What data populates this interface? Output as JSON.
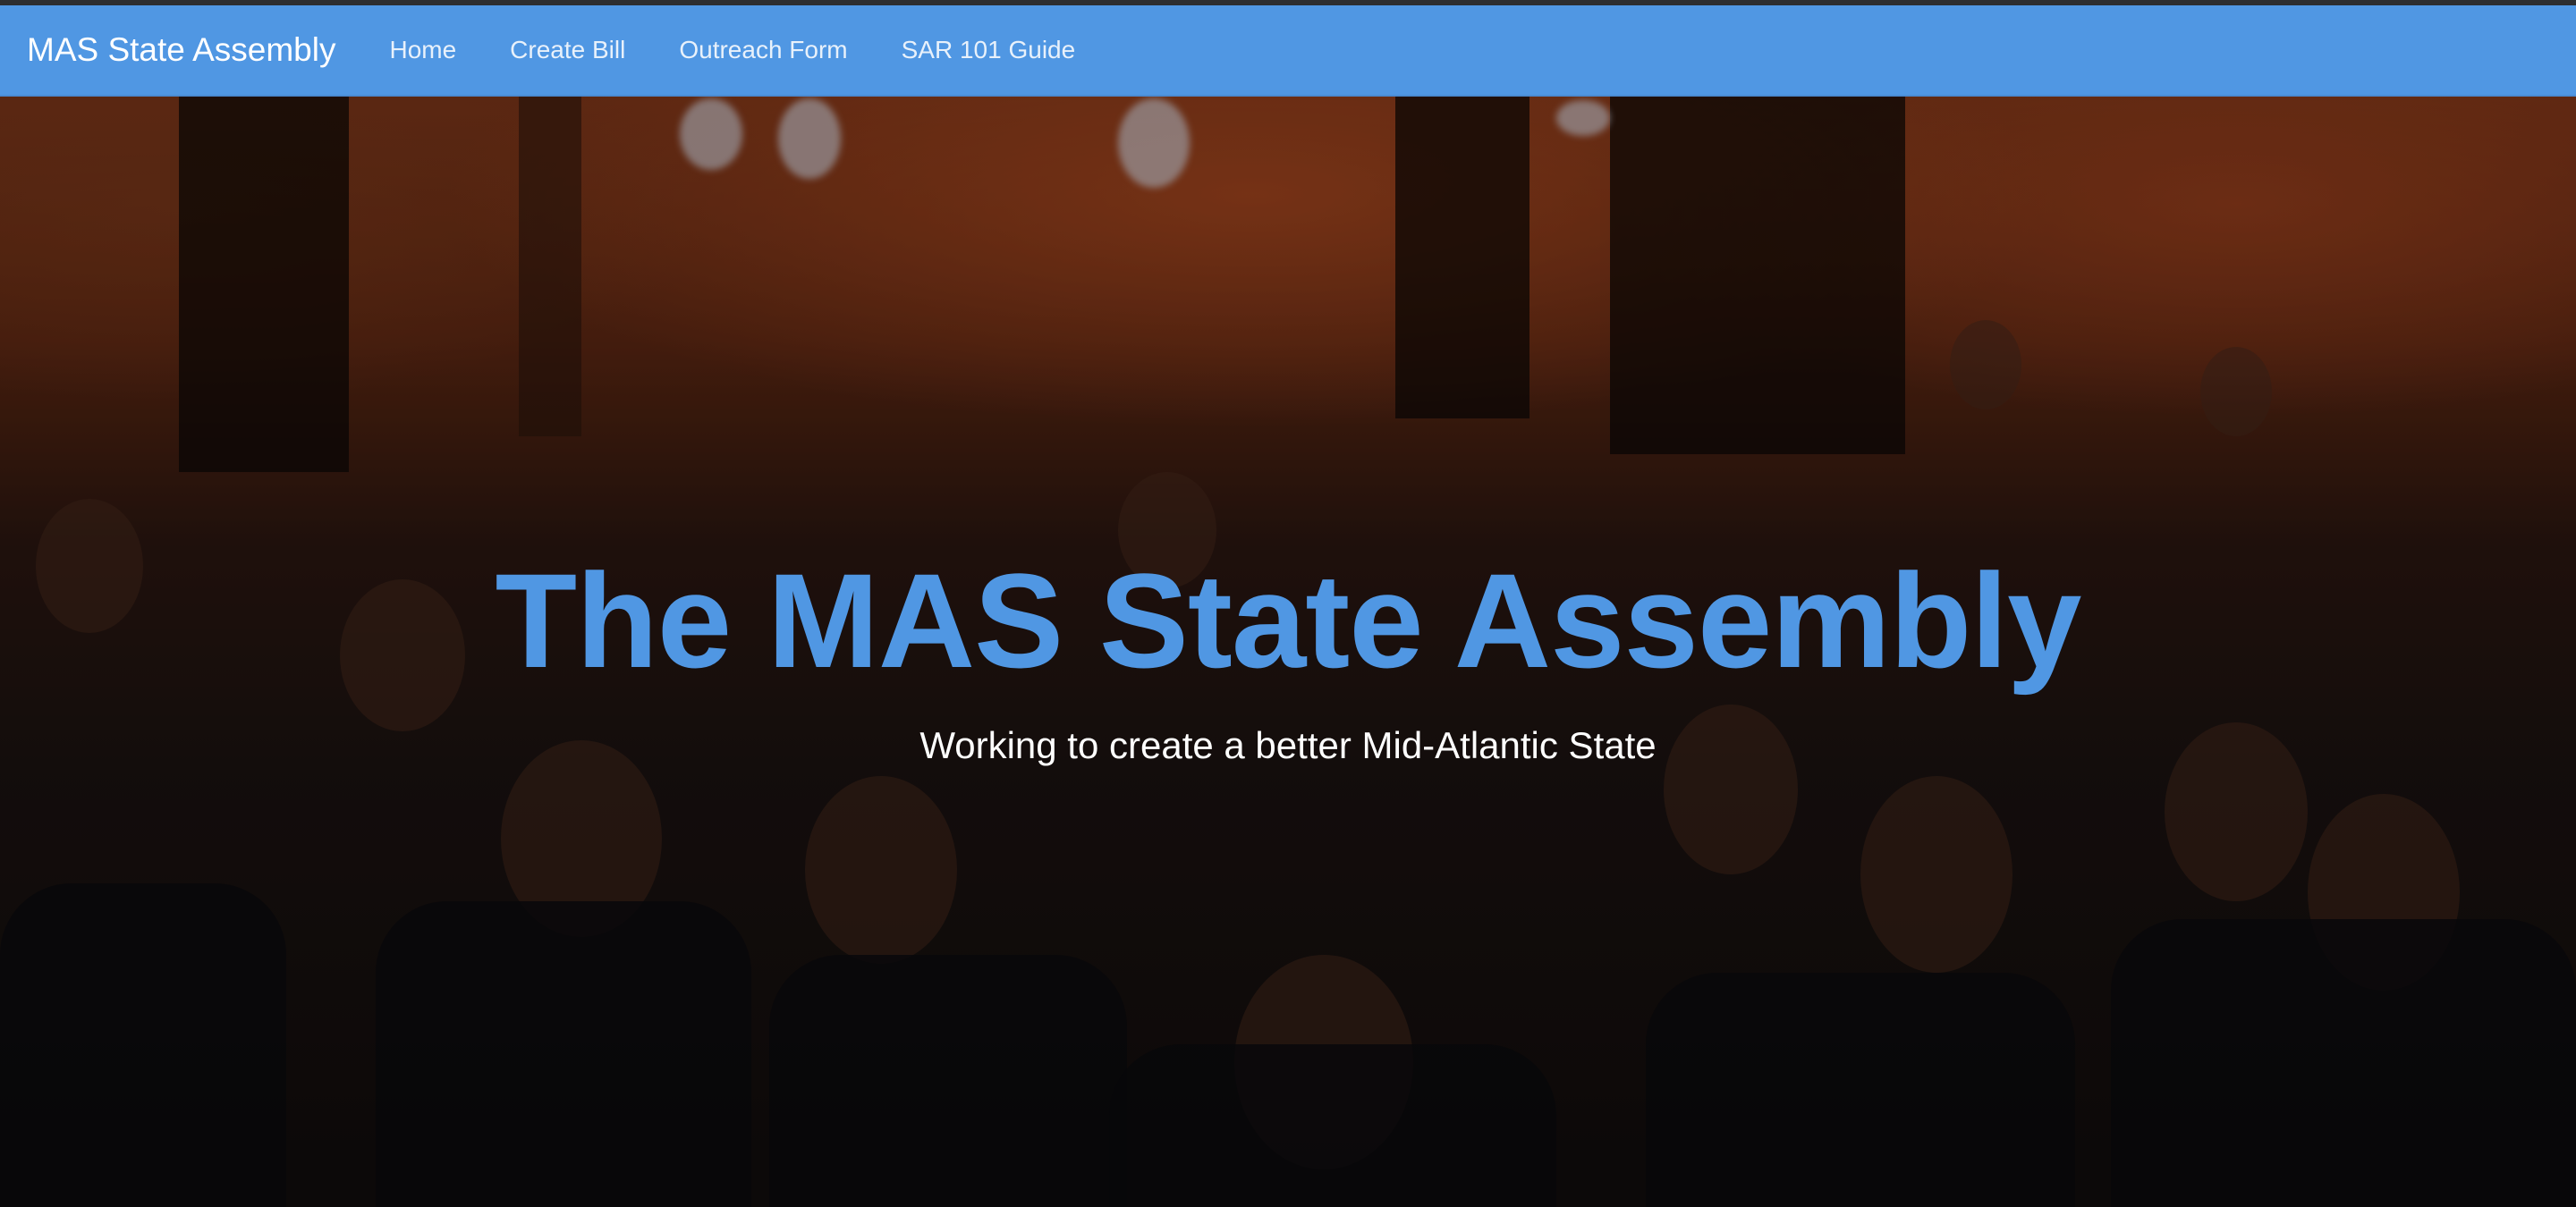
{
  "navbar": {
    "brand": "MAS State Assembly",
    "links": [
      "Home",
      "Create Bill",
      "Outreach Form",
      "SAR 101 Guide"
    ],
    "background_color": "#5097e3"
  },
  "hero": {
    "title": "The MAS State Assembly",
    "subtitle": "Working to create a better Mid-Atlantic State",
    "title_color": "#5097e3",
    "subtitle_color": "#ffffff",
    "background_image": "photo of a crowded assembly hall audience"
  }
}
